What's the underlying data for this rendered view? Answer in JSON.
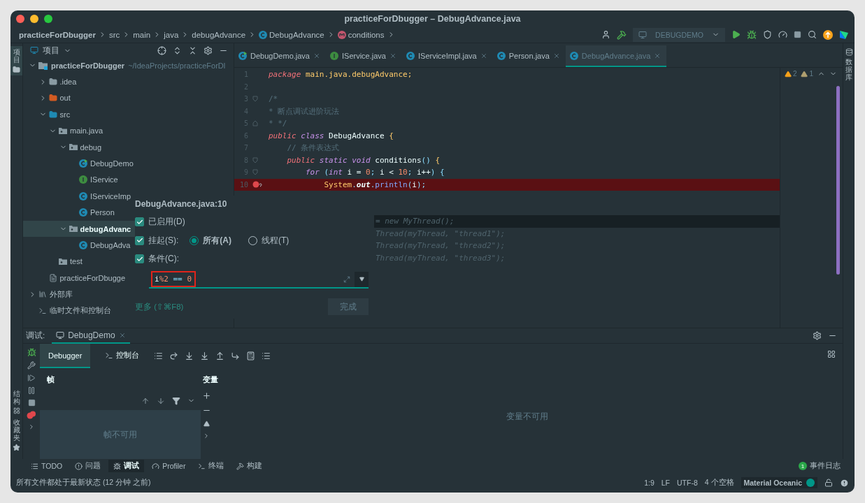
{
  "window": {
    "title": "practiceForDbugger – DebugAdvance.java"
  },
  "breadcrumbs": [
    {
      "label": "practiceForDbugger",
      "kind": "project"
    },
    {
      "label": "src",
      "kind": "plain"
    },
    {
      "label": "main",
      "kind": "plain"
    },
    {
      "label": "java",
      "kind": "plain"
    },
    {
      "label": "debugAdvance",
      "kind": "plain"
    },
    {
      "label": "DebugAdvance",
      "kind": "class"
    },
    {
      "label": "conditions",
      "kind": "method"
    }
  ],
  "run_config": {
    "label": "DEBUGDEMO"
  },
  "left_stripe": {
    "top": [
      {
        "label": "项目",
        "selected": true
      }
    ],
    "bottom": [
      {
        "label": "结构",
        "kind": "structure"
      },
      {
        "label": "收藏夹",
        "kind": "favorites"
      }
    ]
  },
  "right_stripe": [
    {
      "label": "数据库"
    }
  ],
  "project": {
    "title": "项目",
    "tree": [
      {
        "label": "practiceForDbugger",
        "hint": "~/IdeaProjects/practiceForDl",
        "kind": "module",
        "expanded": true,
        "selected": false,
        "children": [
          {
            "label": ".idea",
            "kind": "folder",
            "expanded": false,
            "selected": false
          },
          {
            "label": "out",
            "kind": "excluded",
            "expanded": false,
            "selected": false
          },
          {
            "label": "src",
            "kind": "source",
            "expanded": true,
            "selected": false,
            "children": [
              {
                "label": "main.java",
                "kind": "package",
                "expanded": true,
                "selected": false,
                "children": [
                  {
                    "label": "debug",
                    "kind": "package",
                    "expanded": true,
                    "selected": false,
                    "children": [
                      {
                        "label": "DebugDemo",
                        "kind": "runnable",
                        "selected": false
                      },
                      {
                        "label": "IService",
                        "kind": "interface",
                        "selected": false
                      },
                      {
                        "label": "IServiceImp",
                        "kind": "class",
                        "selected": false
                      },
                      {
                        "label": "Person",
                        "kind": "class",
                        "selected": false
                      }
                    ]
                  },
                  {
                    "label": "debugAdvanc",
                    "kind": "package",
                    "expanded": true,
                    "selected": true,
                    "children": [
                      {
                        "label": "DebugAdva",
                        "kind": "class",
                        "selected": false
                      }
                    ]
                  }
                ]
              },
              {
                "label": "test",
                "kind": "package",
                "selected": false
              }
            ]
          },
          {
            "label": "practiceForDbugge",
            "kind": "file",
            "selected": false
          }
        ]
      },
      {
        "label": "外部库",
        "kind": "library",
        "expanded": false,
        "selected": false
      },
      {
        "label": "临时文件和控制台",
        "kind": "scratch",
        "selected": false
      }
    ]
  },
  "tabs": [
    {
      "label": "DebugDemo.java",
      "kind": "runnable",
      "selected": false
    },
    {
      "label": "IService.java",
      "kind": "interface",
      "selected": false
    },
    {
      "label": "IServiceImpl.java",
      "kind": "class",
      "selected": false
    },
    {
      "label": "Person.java",
      "kind": "class",
      "selected": false
    },
    {
      "label": "DebugAdvance.java",
      "kind": "class",
      "selected": true
    }
  ],
  "inspections": {
    "warnings": "2",
    "weak_warnings": "1"
  },
  "code": [
    {
      "number": "1",
      "tokens": [
        {
          "kind": "modifier",
          "text": "package"
        },
        {
          "kind": "type",
          "text": " main.java.debugAdvance;"
        }
      ]
    },
    {
      "number": "2"
    },
    {
      "number": "3",
      "fold_start": true,
      "tokens": [
        {
          "kind": "comment",
          "text": "/*"
        }
      ]
    },
    {
      "number": "4",
      "tokens": [
        {
          "kind": "comment",
          "text": "* 断点调试进阶玩法"
        }
      ]
    },
    {
      "number": "5",
      "fold_end": true,
      "tokens": [
        {
          "kind": "comment",
          "text": "* */"
        }
      ]
    },
    {
      "number": "6",
      "tokens": [
        {
          "kind": "modifier",
          "text": "public"
        },
        {
          "kind": "keyword",
          "text": " class"
        },
        {
          "kind": "plain",
          "text": " DebugAdvance"
        },
        {
          "kind": "type",
          "text": " {"
        }
      ]
    },
    {
      "number": "7",
      "tokens": [
        {
          "kind": "comment",
          "text": "    // 条件表达式"
        }
      ]
    },
    {
      "number": "8",
      "fold_start": true,
      "tokens": [
        {
          "kind": "modifier",
          "text": "    public"
        },
        {
          "kind": "keyword",
          "text": " static"
        },
        {
          "kind": "keyword",
          "text": " void"
        },
        {
          "kind": "plain",
          "text": " conditions"
        },
        {
          "kind": "punct",
          "text": "()"
        },
        {
          "kind": "type",
          "text": " {"
        }
      ]
    },
    {
      "number": "9",
      "fold_start": true,
      "tokens": [
        {
          "kind": "keyword",
          "text": "        for"
        },
        {
          "kind": "punct",
          "text": " ("
        },
        {
          "kind": "keyword",
          "text": "int"
        },
        {
          "kind": "plain",
          "text": " i = "
        },
        {
          "kind": "number",
          "text": "0"
        },
        {
          "kind": "punct",
          "text": ";"
        },
        {
          "kind": "plain",
          "text": " i < "
        },
        {
          "kind": "number",
          "text": "10"
        },
        {
          "kind": "punct",
          "text": ";"
        },
        {
          "kind": "plain",
          "text": " i++"
        },
        {
          "kind": "punct",
          "text": ")"
        },
        {
          "kind": "punct",
          "text": " {"
        }
      ]
    },
    {
      "number": "10",
      "breakpoint": true,
      "tokens": [
        {
          "kind": "type",
          "text": "            System"
        },
        {
          "kind": "punct",
          "text": "."
        },
        {
          "kind": "field",
          "text": "out"
        },
        {
          "kind": "punct",
          "text": "."
        },
        {
          "kind": "method",
          "text": "println"
        },
        {
          "kind": "punct",
          "text": "("
        },
        {
          "kind": "plain",
          "text": "i"
        },
        {
          "kind": "punct",
          "text": ");"
        }
      ]
    },
    {
      "kind": "covered"
    },
    {
      "kind": "covered"
    },
    {
      "kind": "partial",
      "highlighted": true,
      "tokens": [
        {
          "kind": "faded",
          "text": "= new MyThread();"
        }
      ]
    },
    {
      "kind": "partial",
      "highlighted": false,
      "tokens": [
        {
          "kind": "faded",
          "text": "Thread(myThread, \"thread1\");"
        }
      ]
    },
    {
      "kind": "partial",
      "highlighted": false,
      "tokens": [
        {
          "kind": "faded",
          "text": "Thread(myThread, \"thread2\");"
        }
      ]
    },
    {
      "kind": "partial",
      "highlighted": false,
      "tokens": [
        {
          "kind": "faded",
          "text": "Thread(myThread, \"thread3\");"
        }
      ]
    }
  ],
  "breakpoint_popup": {
    "title": "DebugAdvance.java:10",
    "enabled": {
      "label": "已启用(D)",
      "checked": true
    },
    "suspend": {
      "label": "挂起(S):",
      "checked": true,
      "options": [
        {
          "label": "所有(A)",
          "selected": true
        },
        {
          "label": "线程(T)",
          "selected": false
        }
      ]
    },
    "condition": {
      "label": "条件(C):",
      "checked": true,
      "annotated": true,
      "tokens": [
        {
          "kind": "plain",
          "text": "i"
        },
        {
          "kind": "number",
          "text": "%2"
        },
        {
          "kind": "punct",
          "text": " == "
        },
        {
          "kind": "number",
          "text": "0"
        }
      ]
    },
    "more_link": "更多 (⇧⌘F8)",
    "done_button": "完成"
  },
  "debug": {
    "title": "调试:",
    "session_tab": "DebugDemo",
    "tabs": [
      {
        "label": "Debugger",
        "kind": "debugger",
        "selected": true
      },
      {
        "label": "控制台",
        "kind": "console",
        "selected": false
      }
    ],
    "frames": {
      "title": "帧",
      "empty": "帧不可用"
    },
    "variables": {
      "title": "变量",
      "empty": "变量不可用"
    }
  },
  "tool_windows": [
    {
      "label": "TODO",
      "kind": "todo",
      "selected": false
    },
    {
      "label": "问题",
      "kind": "problems",
      "selected": false
    },
    {
      "label": "调试",
      "kind": "debug",
      "selected": true
    },
    {
      "label": "Profiler",
      "kind": "profiler",
      "selected": false
    },
    {
      "label": "终端",
      "kind": "terminal",
      "selected": false
    },
    {
      "label": "构建",
      "kind": "build",
      "selected": false
    }
  ],
  "event_log": {
    "count": "1",
    "label": "事件日志"
  },
  "status_bar": {
    "message": "所有文件都处于最新状态 (12 分钟 之前)",
    "items": [
      "1:9",
      "LF",
      "UTF-8",
      "4 个空格"
    ],
    "theme": "Material Oceanic"
  }
}
